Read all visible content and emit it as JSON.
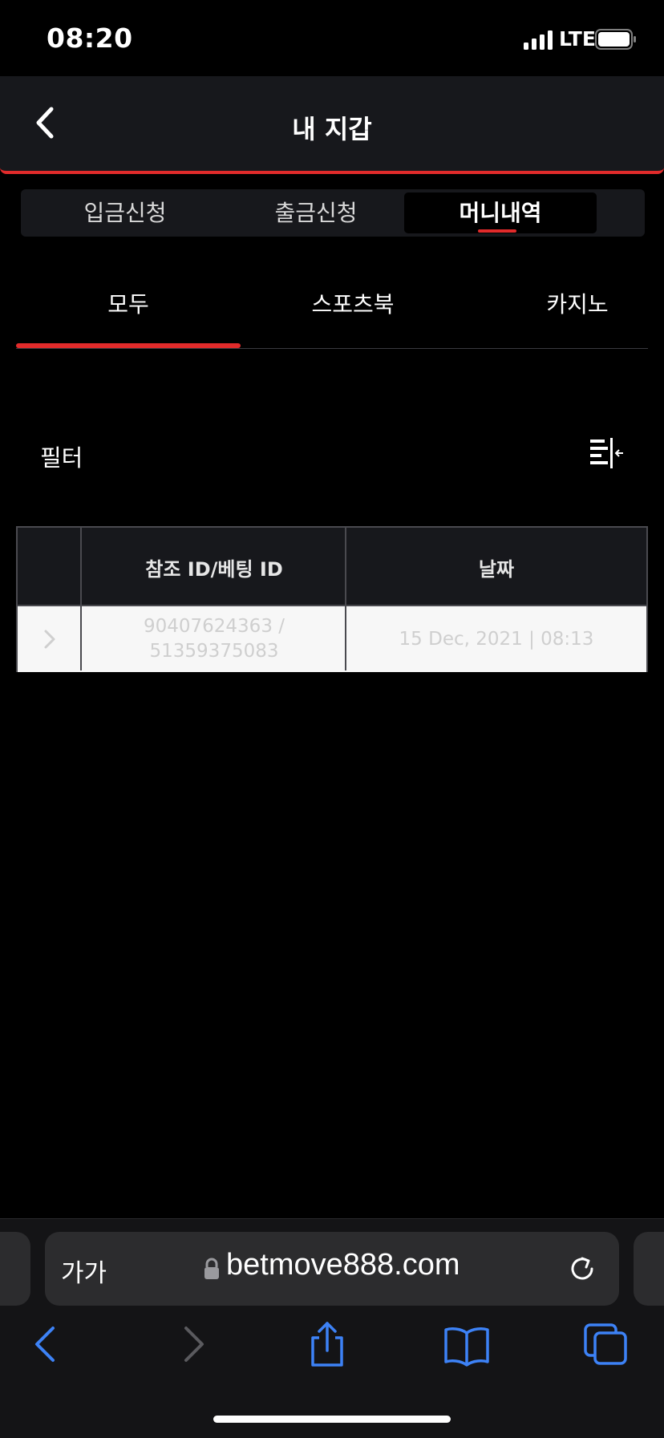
{
  "status_bar": {
    "time": "08:20",
    "network": "LTE"
  },
  "header": {
    "title": "내 지갑"
  },
  "segment_tabs": [
    {
      "label": "입금신청",
      "active": false
    },
    {
      "label": "출금신청",
      "active": false
    },
    {
      "label": "머니내역",
      "active": true
    }
  ],
  "sub_tabs": [
    {
      "label": "모두",
      "active": true
    },
    {
      "label": "스포츠북",
      "active": false
    },
    {
      "label": "카지노",
      "active": false
    }
  ],
  "filter": {
    "label": "필터"
  },
  "table": {
    "headers": [
      "",
      "참조 ID/베팅 ID",
      "날짜"
    ],
    "rows": [
      {
        "ref_id": "90407624363 /",
        "bet_id": "51359375083",
        "date": "15 Dec, 2021 | 08:13"
      }
    ]
  },
  "browser": {
    "text_size_label": "가가",
    "url": "betmove888.com"
  },
  "colors": {
    "accent": "#e12b2b",
    "panel": "#17181c",
    "browser_blue": "#3d82f6"
  }
}
